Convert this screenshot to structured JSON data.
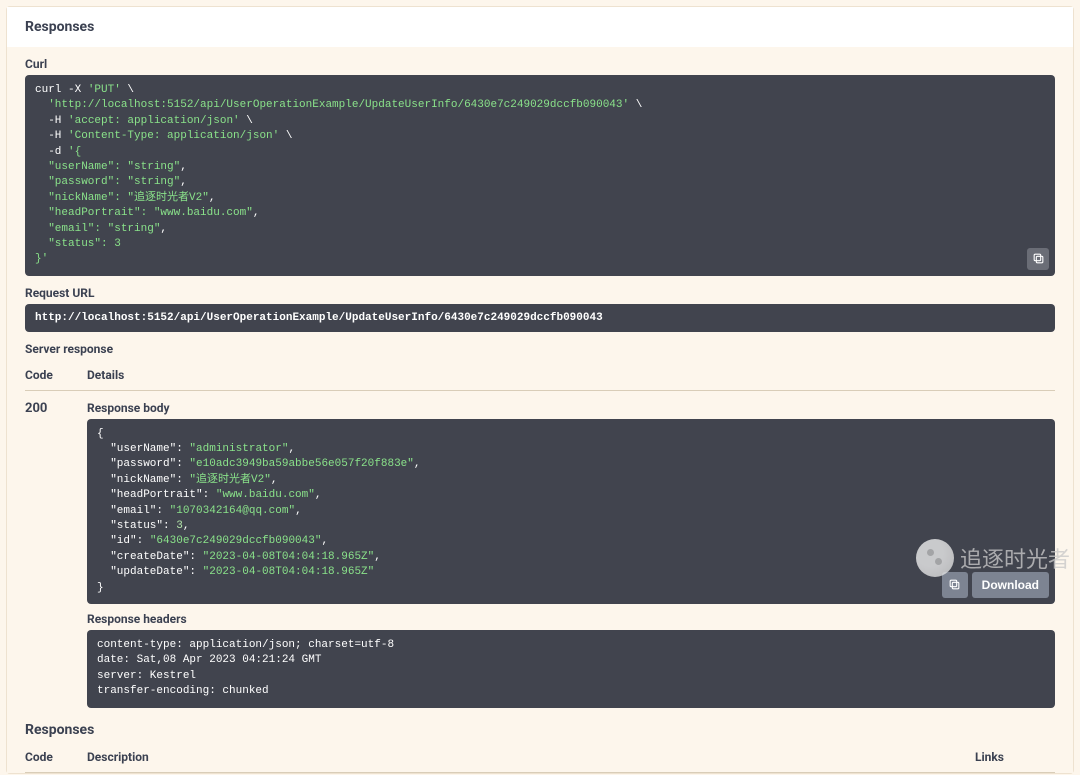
{
  "header": {
    "title": "Responses"
  },
  "curl": {
    "label": "Curl",
    "cmd_prefix": "curl -X ",
    "method": "'PUT'",
    "url": "'http://localhost:5152/api/UserOperationExample/UpdateUserInfo/6430e7c249029dccfb090043'",
    "h1": "'accept: application/json'",
    "h2": "'Content-Type: application/json'",
    "body_open": "'{",
    "body_lines": {
      "userName": "\"userName\": \"string\"",
      "password": "\"password\": \"string\"",
      "nickName": "\"nickName\": \"追逐时光者V2\"",
      "headPortrait": "\"headPortrait\": \"www.baidu.com\"",
      "email": "\"email\": \"string\"",
      "status": "\"status\": 3"
    },
    "body_close": "}'"
  },
  "request": {
    "label": "Request URL",
    "url": "http://localhost:5152/api/UserOperationExample/UpdateUserInfo/6430e7c249029dccfb090043"
  },
  "server": {
    "label": "Server response",
    "code_header": "Code",
    "details_header": "Details",
    "code": "200",
    "body_label": "Response body",
    "headers_label": "Response headers",
    "download": "Download",
    "body": {
      "userName": "administrator",
      "password": "e10adc3949ba59abbe56e057f20f883e",
      "nickName": "追逐时光者V2",
      "headPortrait": "www.baidu.com",
      "email": "1070342164@qq.com",
      "status": "3",
      "id": "6430e7c249029dccfb090043",
      "createDate": "2023-04-08T04:04:18.965Z",
      "updateDate": "2023-04-08T04:04:18.965Z"
    },
    "headers": {
      "contentType": "content-type: application/json; charset=utf-8",
      "date": "date: Sat,08 Apr 2023 04:21:24 GMT",
      "server": "server: Kestrel",
      "transferEncoding": "transfer-encoding: chunked"
    }
  },
  "responses_section": {
    "label": "Responses",
    "code_header": "Code",
    "desc_header": "Description",
    "links_header": "Links"
  },
  "watermark": {
    "text": "追逐时光者"
  }
}
